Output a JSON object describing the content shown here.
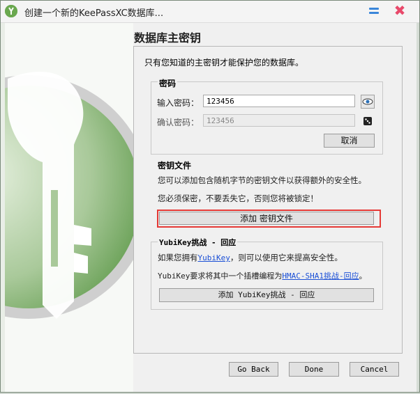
{
  "window": {
    "title": "创建一个新的KeePassXC数据库...",
    "min_icon": "minimize-icon",
    "close_icon": "close-icon",
    "close_glyph": "✖"
  },
  "page": {
    "title": "数据库主密钥",
    "intro": "只有您知道的主密钥才能保护您的数据库。"
  },
  "password": {
    "group_title": "密码",
    "enter_label": "输入密码：",
    "enter_value": "123456",
    "confirm_label": "确认密码：",
    "confirm_value": "123456",
    "eye_icon": "show-password-icon",
    "dice_icon": "password-generator-icon",
    "cancel_label": "取消"
  },
  "keyfile": {
    "group_title": "密钥文件",
    "desc1": "您可以添加包含随机字节的密钥文件以获得额外的安全性。",
    "desc2": "您必须保密，不要丢失它，否则您将被锁定！",
    "add_label": "添加 密钥文件"
  },
  "yubikey": {
    "group_title": "YubiKey挑战 - 回应",
    "line1_prefix": "如果您拥有",
    "line1_link": "YubiKey",
    "line1_suffix": "，则可以使用它来提高安全性。",
    "line2_prefix": "YubiKey要求将其中一个插槽编程为",
    "line2_link": "HMAC-SHA1挑战-回应",
    "line2_suffix": "。",
    "add_label": "添加 YubiKey挑战 - 回应"
  },
  "footer": {
    "back_label": "Go Back",
    "done_label": "Done",
    "cancel_label": "Cancel"
  },
  "colors": {
    "accent_green": "#6aa84f",
    "highlight_red": "#e53935",
    "link_blue": "#1a4fd6"
  }
}
